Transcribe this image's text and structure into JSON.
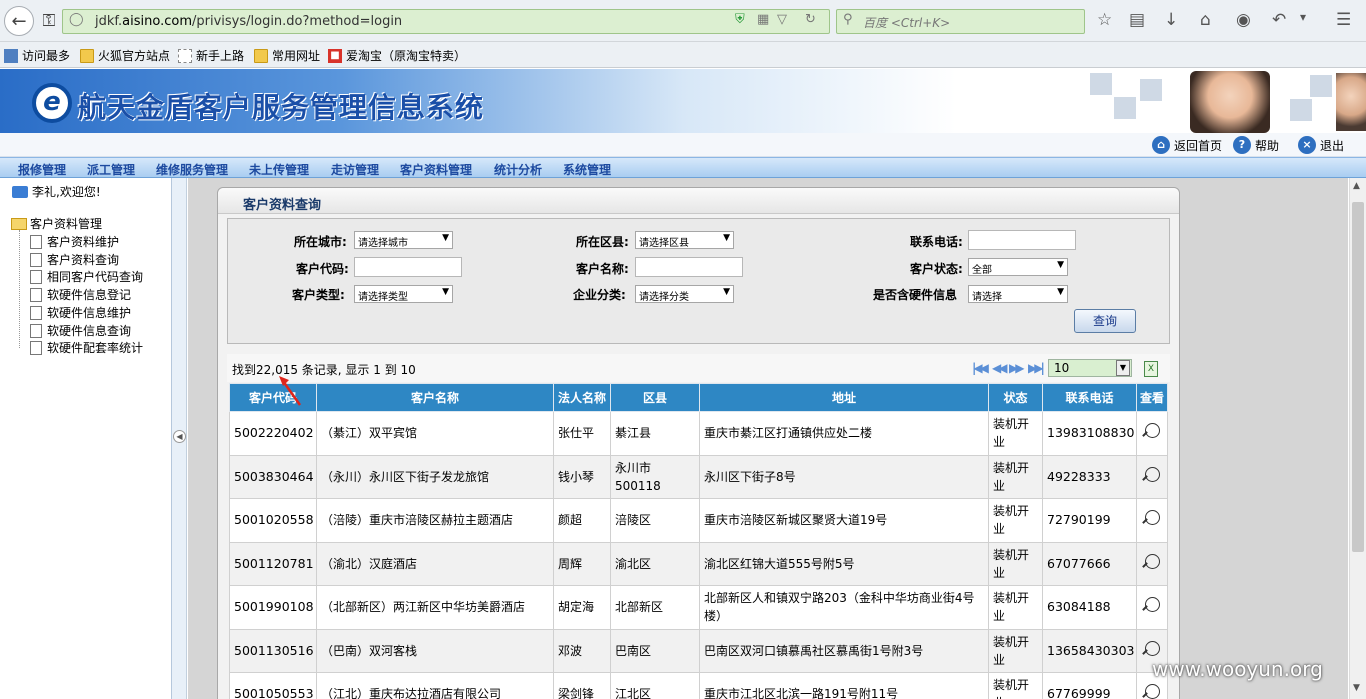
{
  "browser": {
    "url_host": "jdkf.",
    "url_domain": "aisino.com",
    "url_path": "/privisys/login.do?method=login",
    "search_placeholder": "百度 <Ctrl+K>"
  },
  "bookmarks": [
    "访问最多",
    "火狐官方站点",
    "新手上路",
    "常用网址",
    "爱淘宝（原淘宝特卖）"
  ],
  "banner": {
    "logo_letter": "e",
    "title": "航天金盾客户服务管理信息系统"
  },
  "subbar": {
    "home": "返回首页",
    "help": "帮助",
    "logout": "退出"
  },
  "menu": [
    "报修管理",
    "派工管理",
    "维修服务管理",
    "未上传管理",
    "走访管理",
    "客户资料管理",
    "统计分析",
    "系统管理"
  ],
  "sidebar": {
    "welcome": "李礼,欢迎您!",
    "root": "客户资料管理",
    "items": [
      "客户资料维护",
      "客户资料查询",
      "相同客户代码查询",
      "软硬件信息登记",
      "软硬件信息维护",
      "软硬件信息查询",
      "软硬件配套率统计"
    ]
  },
  "panel_title": "客户资料查询",
  "filters": {
    "city_label": "所在城市:",
    "city_value": "请选择城市",
    "county_label": "所在区县:",
    "county_value": "请选择区县",
    "phone_label": "联系电话:",
    "phone_value": "",
    "code_label": "客户代码:",
    "code_value": "",
    "name_label": "客户名称:",
    "name_value": "",
    "status_label": "客户状态:",
    "status_value": "全部",
    "type_label": "客户类型:",
    "type_value": "请选择类型",
    "category_label": "企业分类:",
    "category_value": "请选择分类",
    "hw_label": "是否含硬件信息",
    "hw_value": "请选择",
    "query_button": "查询"
  },
  "results": {
    "summary": "找到22,015 条记录, 显示 1 到 10",
    "page_size": "10"
  },
  "table": {
    "headers": [
      "客户代码",
      "客户名称",
      "法人名称",
      "区县",
      "地址",
      "状态",
      "联系电话",
      "查看"
    ],
    "rows": [
      {
        "code": "5002220402",
        "name": "（綦江）双平宾馆",
        "legal": "张仕平",
        "county": "綦江县",
        "address": "重庆市綦江区打通镇供应处二楼",
        "status": "装机开业",
        "phone": "13983108830"
      },
      {
        "code": "5003830464",
        "name": "（永川）永川区下街子发龙旅馆",
        "legal": "钱小琴",
        "county": "永川市500118",
        "address": "永川区下街子8号",
        "status": "装机开业",
        "phone": "49228333"
      },
      {
        "code": "5001020558",
        "name": "（涪陵）重庆市涪陵区赫拉主题酒店",
        "legal": "颜超",
        "county": "涪陵区",
        "address": "重庆市涪陵区新城区聚贤大道19号",
        "status": "装机开业",
        "phone": "72790199"
      },
      {
        "code": "5001120781",
        "name": "（渝北）汉庭酒店",
        "legal": "周辉",
        "county": "渝北区",
        "address": "渝北区红锦大道555号附5号",
        "status": "装机开业",
        "phone": "67077666"
      },
      {
        "code": "5001990108",
        "name": "（北部新区）两江新区中华坊美爵酒店",
        "legal": "胡定海",
        "county": "北部新区",
        "address": "北部新区人和镇双宁路203（金科中华坊商业街4号楼）",
        "status": "装机开业",
        "phone": "63084188"
      },
      {
        "code": "5001130516",
        "name": "（巴南）双河客栈",
        "legal": "邓波",
        "county": "巴南区",
        "address": "巴南区双河口镇慕禹社区慕禹街1号附3号",
        "status": "装机开业",
        "phone": "13658430303"
      },
      {
        "code": "5001050553",
        "name": "（江北）重庆布达拉酒店有限公司",
        "legal": "梁剑锋",
        "county": "江北区",
        "address": "重庆市江北区北滨一路191号附11号",
        "status": "装机开业",
        "phone": "67769999"
      }
    ]
  },
  "watermark": "www.wooyun.org"
}
